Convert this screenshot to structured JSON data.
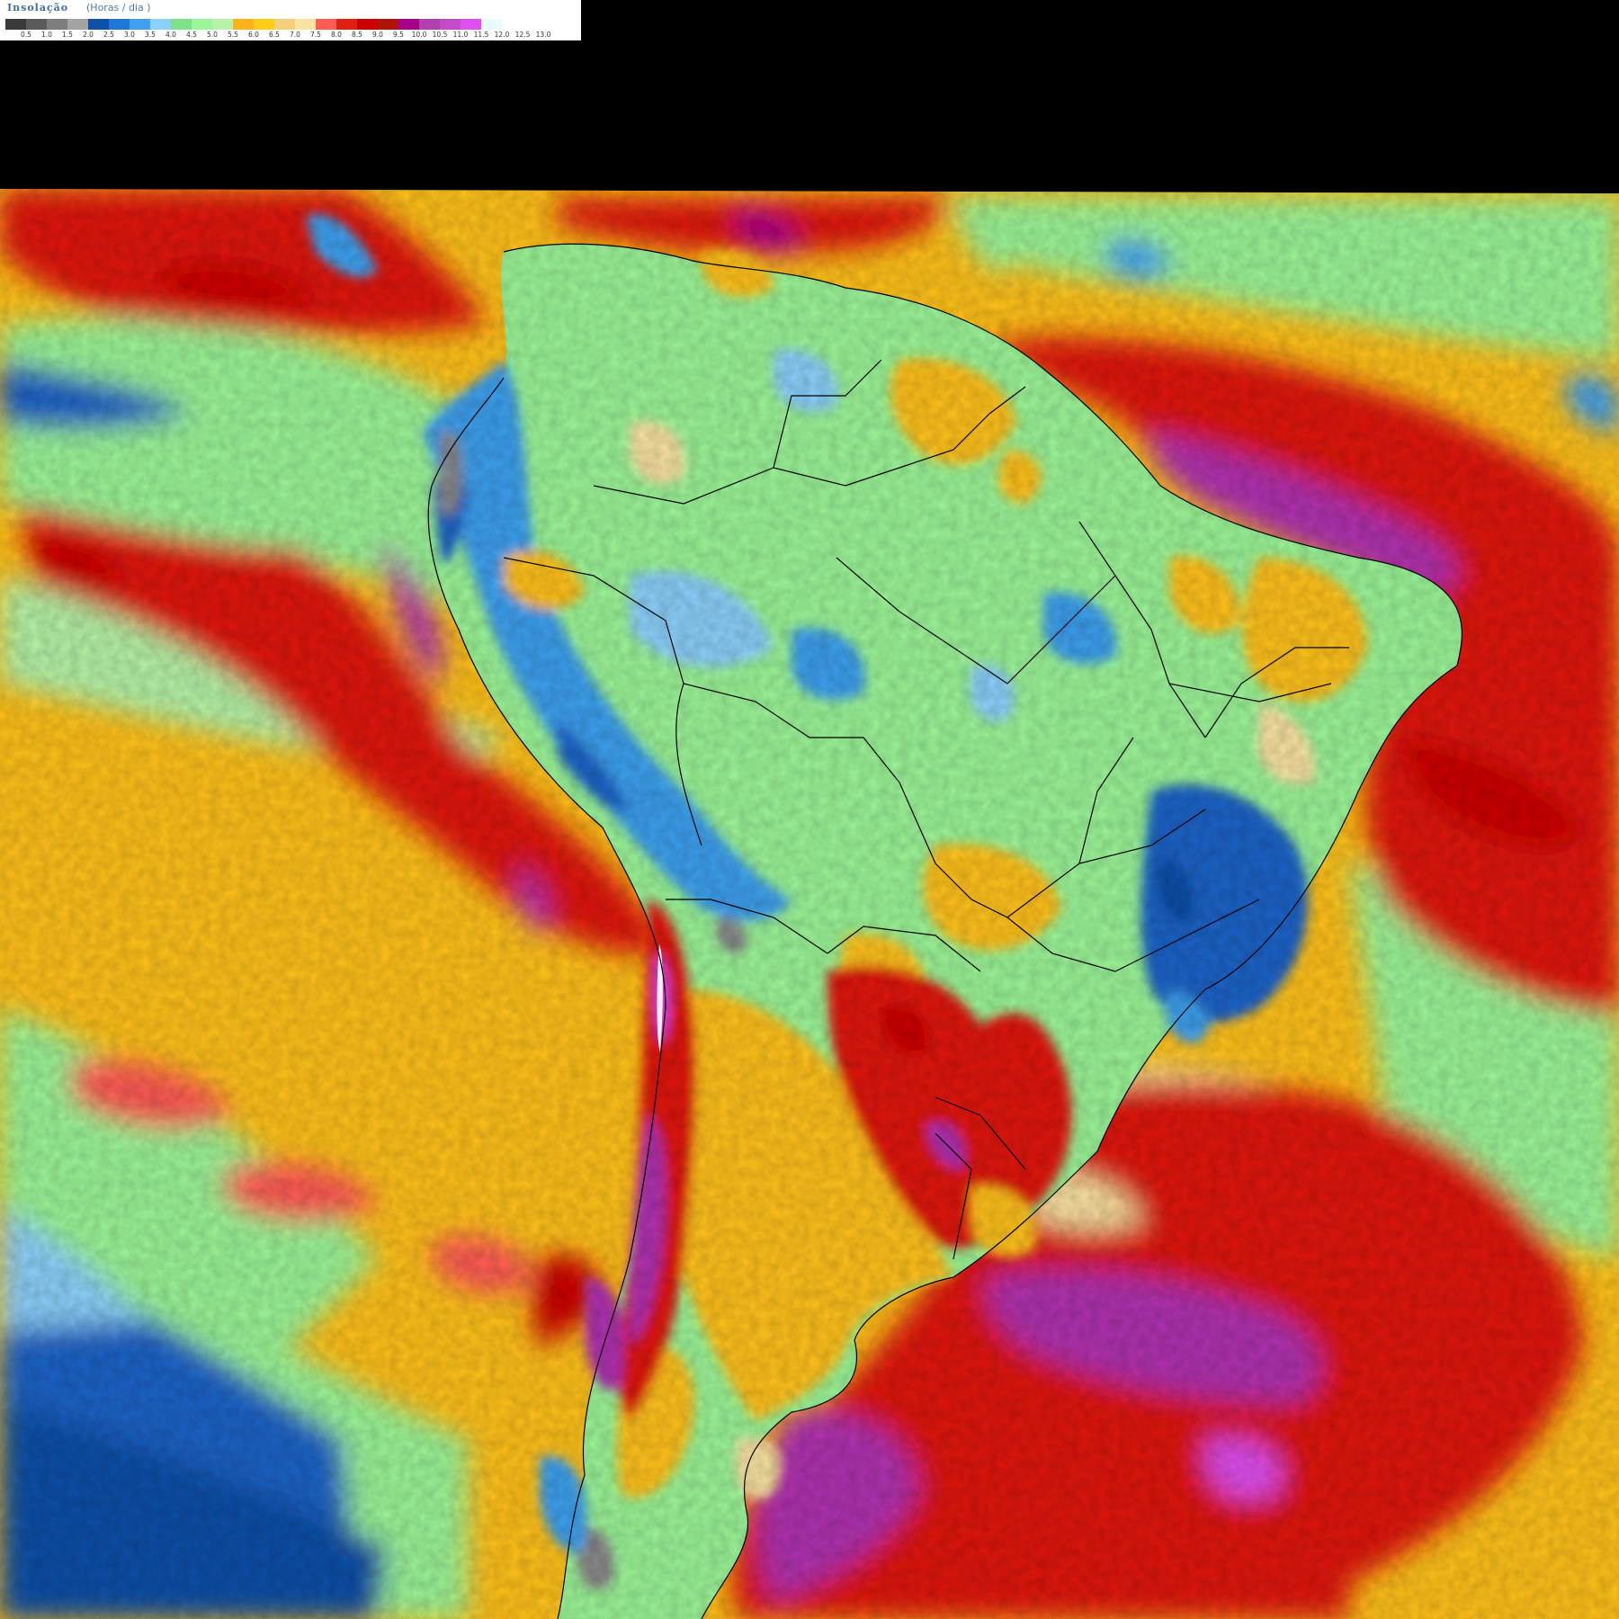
{
  "legend": {
    "title": "Insolação",
    "unit": "(Horas / dia )",
    "colors": [
      "#3a3a3a",
      "#5a5a5a",
      "#7d7d7d",
      "#a3a3a3",
      "#0e4fa8",
      "#1f78d8",
      "#3ea0ee",
      "#8cd0fb",
      "#7fe08a",
      "#9cf598",
      "#b6f3a8",
      "#ffb21a",
      "#ffcc18",
      "#f4d07d",
      "#f9e3a2",
      "#ff5a54",
      "#e02010",
      "#cc0000",
      "#b01208",
      "#a8008a",
      "#b040b0",
      "#c24cc8",
      "#e050f0",
      "#e8fcff",
      "#ffffff"
    ],
    "ticks": [
      "0.5",
      "1.0",
      "1.5",
      "2.0",
      "2.5",
      "3.0",
      "3.5",
      "4.0",
      "4.5",
      "5.0",
      "5.5",
      "6.0",
      "6.5",
      "7.0",
      "7.5",
      "8.0",
      "8.5",
      "9.0",
      "9.5",
      "10.0",
      "10.5",
      "11.0",
      "11.5",
      "12.0",
      "12.5",
      "13.0"
    ]
  },
  "map": {
    "title": "",
    "region": "South America",
    "variable": "Insolação",
    "units": "Horas / dia",
    "background": "#000000",
    "no_data_color": "#000000",
    "border_color": "#000000",
    "palette": {
      "gray": "#8a8a8a",
      "dark_blue": "#1a63c8",
      "light_blue": "#8cd0fb",
      "green": "#9cf598",
      "light_green": "#b6f3a8",
      "orange": "#ffc21a",
      "pale_yellow": "#f9e3a2",
      "red": "#e01810",
      "purple": "#b030b0",
      "magenta": "#e050f0",
      "white": "#ffffff"
    }
  }
}
